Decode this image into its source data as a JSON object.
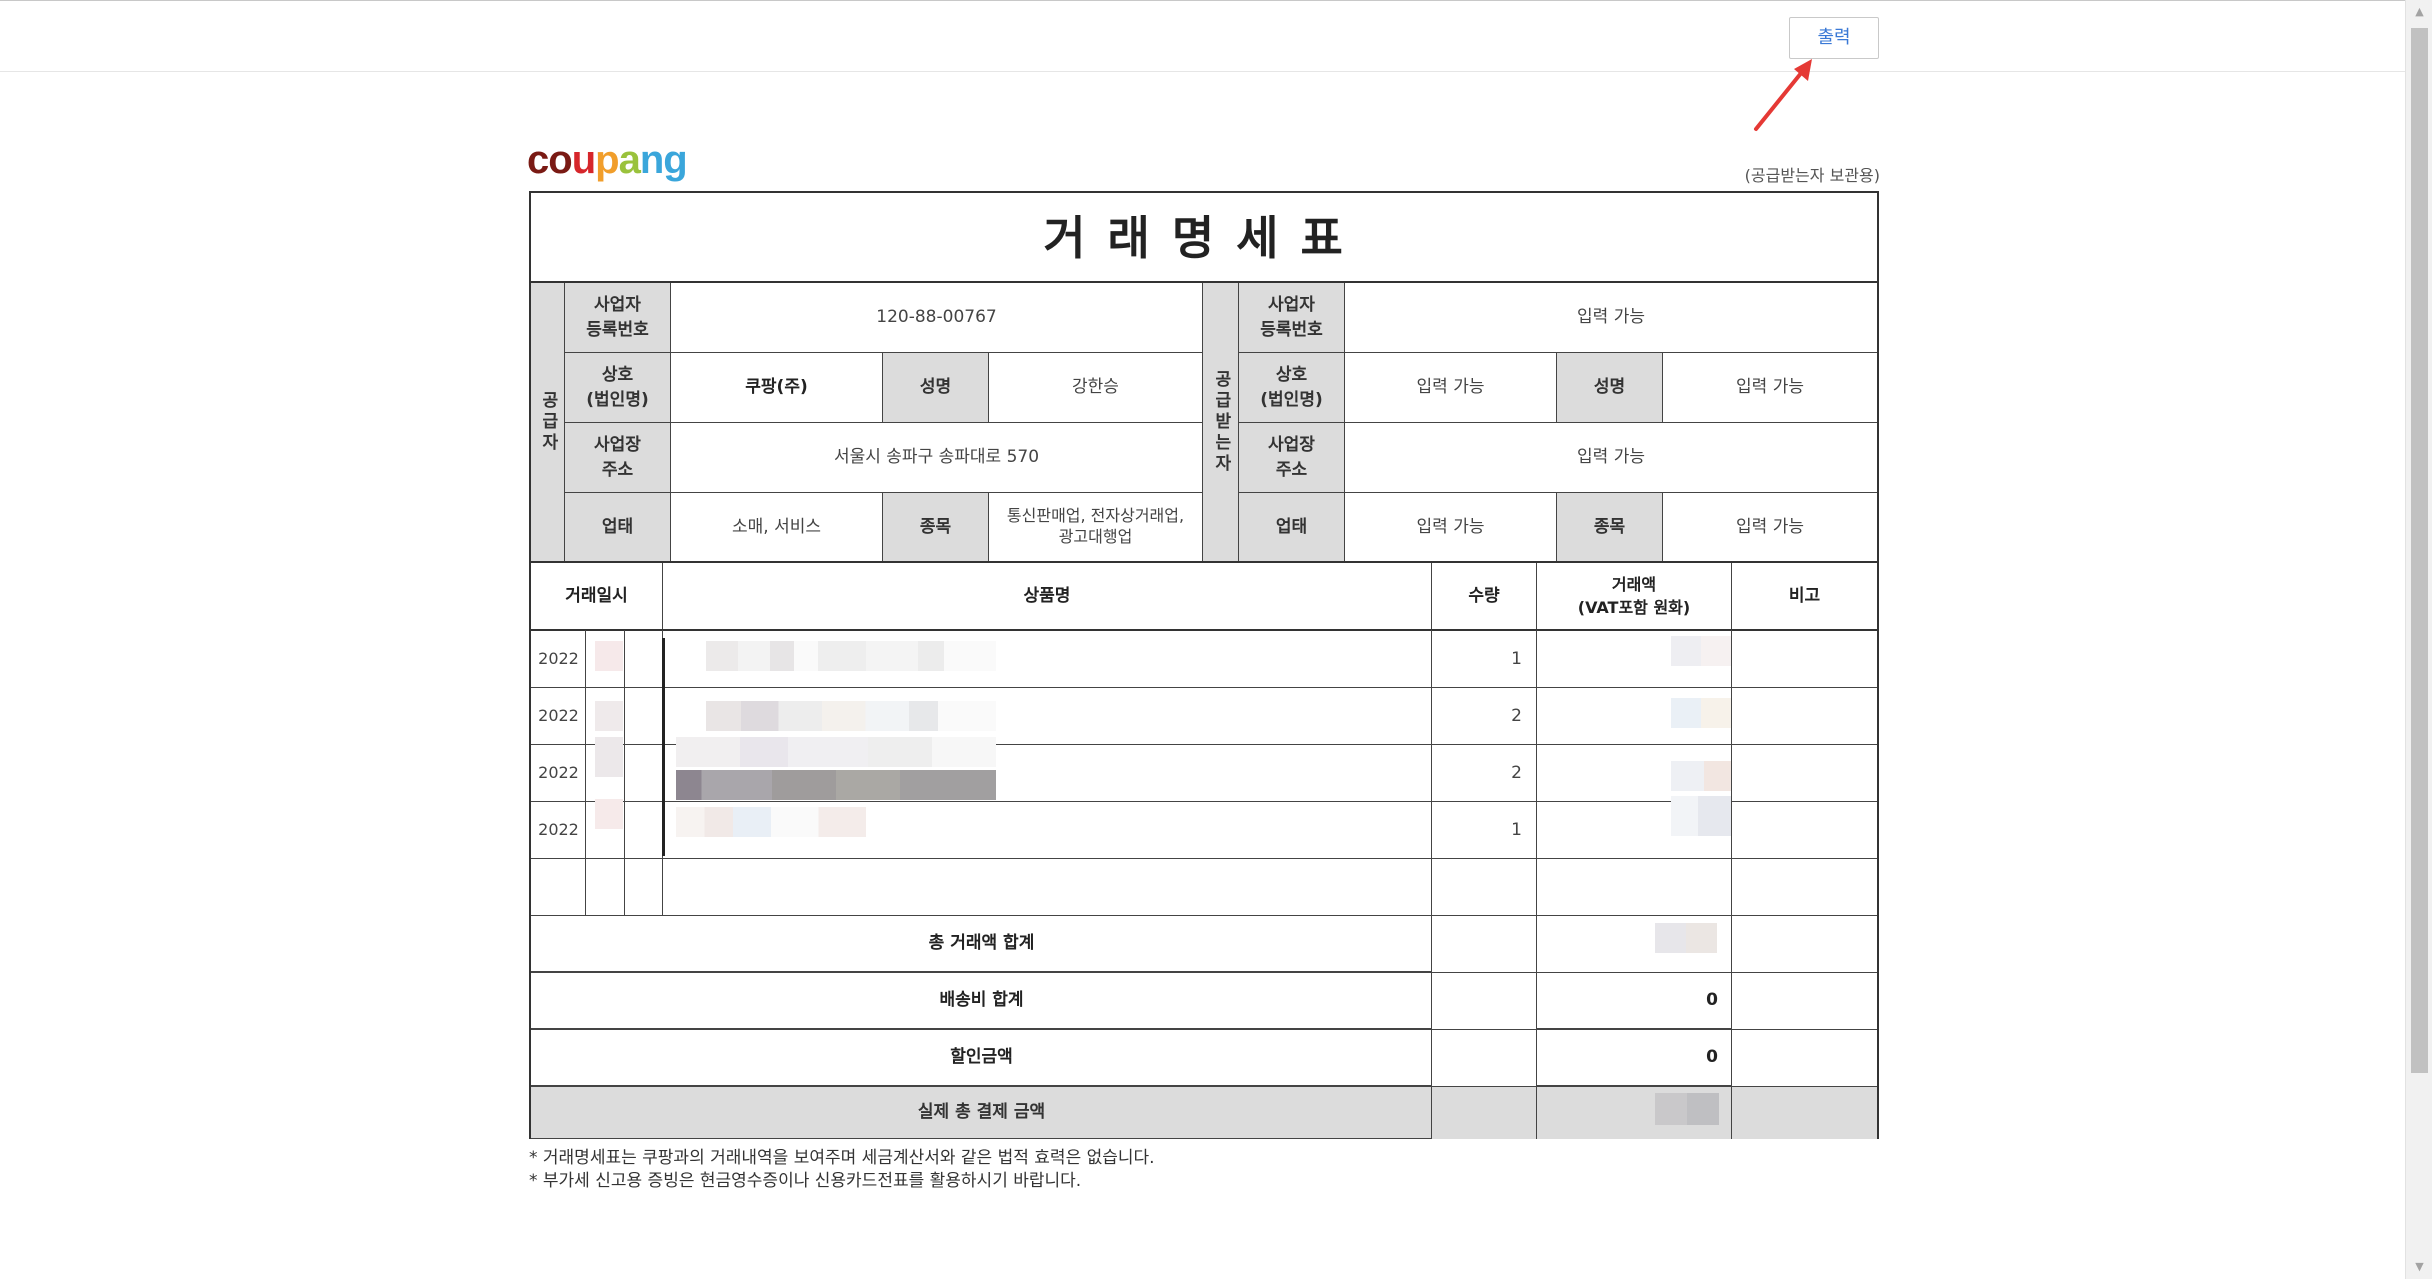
{
  "toolbar": {
    "print_label": "출력"
  },
  "brand": {
    "logo_letters": [
      "c",
      "o",
      "u",
      "p",
      "a",
      "n",
      "g"
    ],
    "logo_text": "coupang"
  },
  "copy_note": "(공급받는자 보관용)",
  "doc_title": "거래명세표",
  "supplier": {
    "side_label": "공급자",
    "reg_label": "사업자\n등록번호",
    "reg_value": "120-88-00767",
    "company_label": "상호\n(법인명)",
    "company_value": "쿠팡(주)",
    "name_label": "성명",
    "name_value": "강한승",
    "address_label": "사업장\n주소",
    "address_value": "서울시 송파구 송파대로 570",
    "biz_type_label": "업태",
    "biz_type_value": "소매, 서비스",
    "biz_item_label": "종목",
    "biz_item_value": "통신판매업, 전자상거래업,\n광고대행업"
  },
  "receiver": {
    "side_label": "공급받는자",
    "reg_label": "사업자\n등록번호",
    "reg_value": "입력 가능",
    "company_label": "상호\n(법인명)",
    "company_value": "입력 가능",
    "name_label": "성명",
    "name_value": "입력 가능",
    "address_label": "사업장\n주소",
    "address_value": "입력 가능",
    "biz_type_label": "업태",
    "biz_type_value": "입력 가능",
    "biz_item_label": "종목",
    "biz_item_value": "입력 가능"
  },
  "items_header": {
    "date": "거래일시",
    "product": "상품명",
    "qty": "수량",
    "amount": "거래액\n(VAT포함 원화)",
    "note": "비고"
  },
  "items": [
    {
      "date": "2022",
      "qty": "1"
    },
    {
      "date": "2022",
      "qty": "2"
    },
    {
      "date": "2022",
      "qty": "2"
    },
    {
      "date": "2022",
      "qty": "1"
    }
  ],
  "totals": {
    "total_label": "총 거래액 합계",
    "shipping_label": "배송비 합계",
    "shipping_value": "0",
    "discount_label": "할인금액",
    "discount_value": "0",
    "final_label": "실제 총 결제 금액"
  },
  "notes": [
    "* 거래명세표는 쿠팡과의 거래내역을 보여주며 세금계산서와 같은 법적 효력은 없습니다.",
    "* 부가세 신고용 증빙은 현금영수증이나 신용카드전표를 활용하시기 바랍니다."
  ],
  "colors": {
    "accent": "#3a79d6",
    "header_gray": "#dcdcdc",
    "arrow": "#e53935"
  }
}
